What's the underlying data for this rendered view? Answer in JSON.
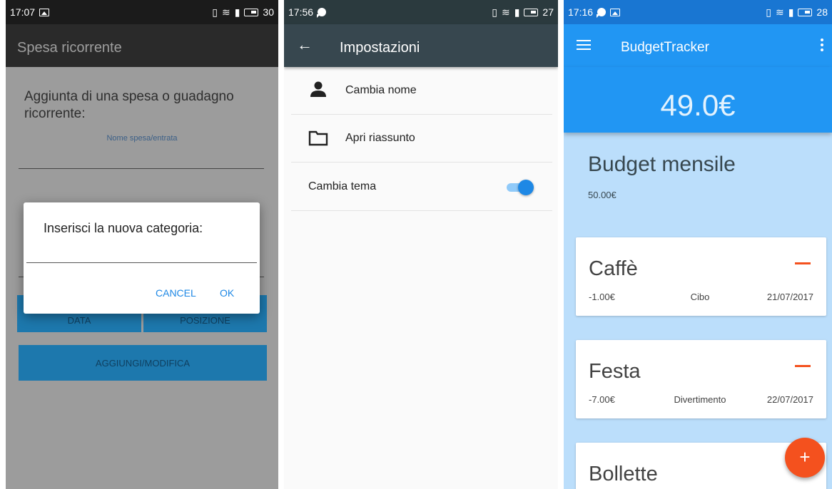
{
  "screens": [
    {
      "status": {
        "time": "17:07",
        "battery": "30"
      },
      "appbar": {
        "title": "Spesa ricorrente"
      },
      "heading": "Aggiunta di una spesa o guadagno ricorrente:",
      "field_label": "Nome spesa/entrata",
      "buttons": {
        "data": "DATA",
        "posizione": "POSIZIONE",
        "add": "AGGIUNGI/MODIFICA"
      },
      "dialog": {
        "title": "Inserisci la nuova categoria:",
        "input_value": "",
        "cancel": "CANCEL",
        "ok": "OK"
      }
    },
    {
      "status": {
        "time": "17:56",
        "battery": "27"
      },
      "appbar": {
        "title": "Impostazioni",
        "back_icon": "arrow-back-icon"
      },
      "settings": [
        {
          "label": "Cambia nome",
          "icon": "person-icon"
        },
        {
          "label": "Apri riassunto",
          "icon": "folder-icon"
        },
        {
          "label": "Cambia tema",
          "toggle": true
        }
      ]
    },
    {
      "status": {
        "time": "17:16",
        "battery": "28"
      },
      "appbar": {
        "title": "BudgetTracker",
        "menu_icon": "menu-icon",
        "more_icon": "more-vert-icon"
      },
      "balance": "49.0€",
      "budget": {
        "title": "Budget mensile",
        "amount": "50.00€"
      },
      "entries": [
        {
          "name": "Caffè",
          "amount": "-1.00€",
          "category": "Cibo",
          "date": "21/07/2017"
        },
        {
          "name": "Festa",
          "amount": "-7.00€",
          "category": "Divertimento",
          "date": "22/07/2017"
        },
        {
          "name": "Bollette"
        }
      ],
      "fab": "+",
      "colors": {
        "primary": "#2196f3",
        "accent": "#f4511e",
        "background": "#bbdefb"
      }
    }
  ]
}
